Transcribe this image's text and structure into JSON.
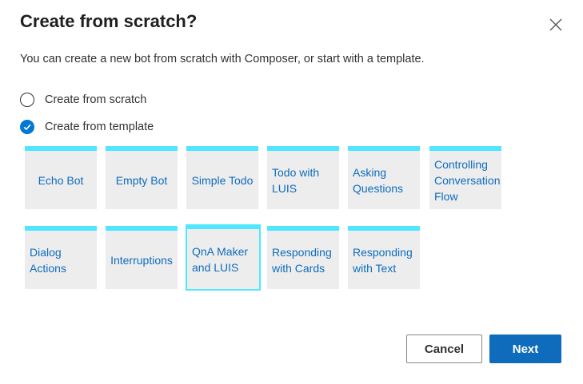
{
  "dialog": {
    "title": "Create from scratch?",
    "subtitle": "You can create a new bot from scratch with Composer, or start with a template."
  },
  "options": [
    {
      "label": "Create from scratch",
      "selected": false
    },
    {
      "label": "Create from template",
      "selected": true
    }
  ],
  "templates": [
    {
      "label": "Echo Bot"
    },
    {
      "label": "Empty Bot"
    },
    {
      "label": "Simple Todo"
    },
    {
      "label": "Todo with LUIS"
    },
    {
      "label": "Asking Questions"
    },
    {
      "label": "Controlling Conversation Flow"
    },
    {
      "label": "Dialog Actions"
    },
    {
      "label": "Interruptions"
    },
    {
      "label": "QnA Maker and LUIS",
      "selected": true
    },
    {
      "label": "Responding with Cards"
    },
    {
      "label": "Responding with Text"
    }
  ],
  "buttons": {
    "cancel": "Cancel",
    "next": "Next"
  },
  "colors": {
    "accent": "#0f6cbd",
    "tile_top": "#50e6ff",
    "tile_bg": "#ededed"
  },
  "icons": {
    "close": "close-icon",
    "check": "checkmark-icon"
  }
}
